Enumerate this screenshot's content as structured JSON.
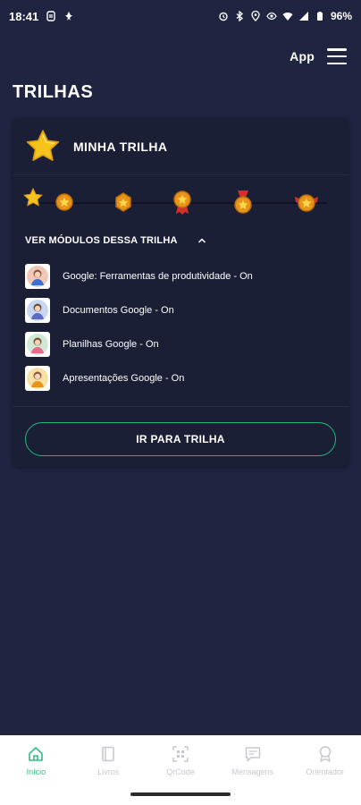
{
  "status": {
    "time": "18:41",
    "battery": "96%"
  },
  "header": {
    "app_logo": "App"
  },
  "page": {
    "title": "TRILHAS"
  },
  "card": {
    "title": "MINHA TRILHA",
    "toggle_label": "VER MÓDULOS DESSA TRILHA",
    "modules": [
      {
        "label": "Google: Ferramentas de produtividade - On",
        "icon": "woman-avatar-icon"
      },
      {
        "label": "Documentos Google - On",
        "icon": "woman-avatar-icon"
      },
      {
        "label": "Planilhas Google - On",
        "icon": "woman-avatar-icon"
      },
      {
        "label": "Apresentações Google - On",
        "icon": "woman-avatar-icon"
      }
    ],
    "button_label": "IR PARA TRILHA"
  },
  "nav": {
    "items": [
      {
        "label": "Início",
        "icon": "home-icon",
        "active": true
      },
      {
        "label": "Livros",
        "icon": "book-icon",
        "active": false
      },
      {
        "label": "QrCode",
        "icon": "qrcode-icon",
        "active": false
      },
      {
        "label": "Mensagens",
        "icon": "message-icon",
        "active": false
      },
      {
        "label": "Orientador",
        "icon": "award-icon",
        "active": false
      }
    ]
  },
  "colors": {
    "background": "#1f2540",
    "card": "#1a1f36",
    "accent": "#1fb67a",
    "star": "#f5c31b",
    "medal": "#e8941a"
  }
}
